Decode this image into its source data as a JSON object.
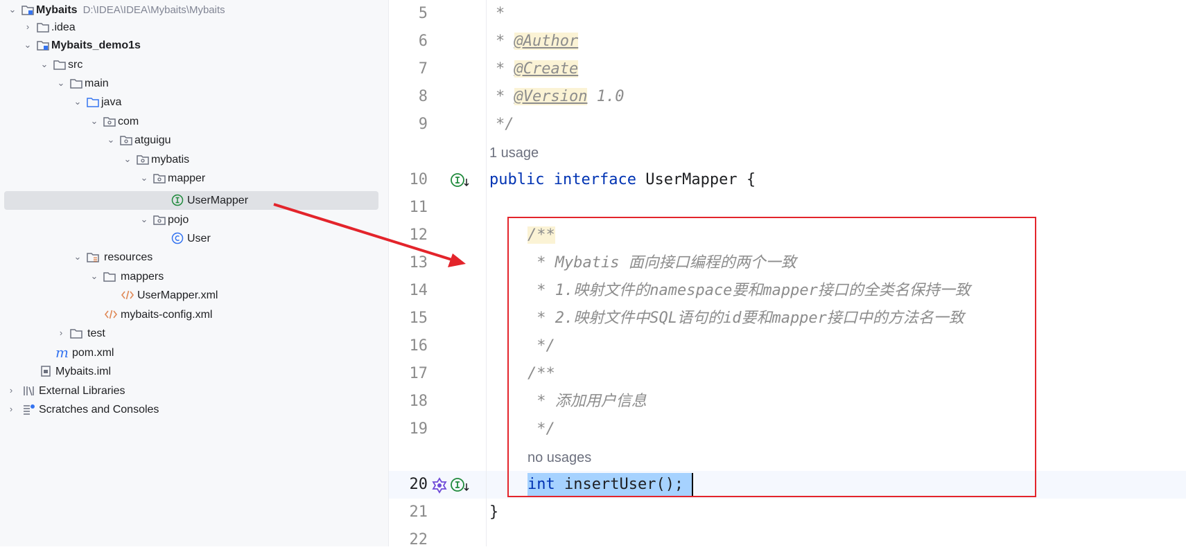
{
  "tree": {
    "root": {
      "name": "Mybaits",
      "path": "D:\\IDEA\\IDEA\\Mybaits\\Mybaits"
    },
    "items": [
      {
        "label": "Mybaits",
        "icon": "module-folder-icon"
      },
      {
        "label": ".idea",
        "icon": "folder-icon"
      },
      {
        "label": "Mybaits_demo1s",
        "icon": "module-folder-icon"
      },
      {
        "label": "src",
        "icon": "folder-icon"
      },
      {
        "label": "main",
        "icon": "folder-icon"
      },
      {
        "label": "java",
        "icon": "source-folder-icon"
      },
      {
        "label": "com",
        "icon": "package-icon"
      },
      {
        "label": "atguigu",
        "icon": "package-icon"
      },
      {
        "label": "mybatis",
        "icon": "package-icon"
      },
      {
        "label": "mapper",
        "icon": "package-icon"
      },
      {
        "label": "UserMapper",
        "icon": "interface-icon"
      },
      {
        "label": "pojo",
        "icon": "package-icon"
      },
      {
        "label": "User",
        "icon": "class-icon"
      },
      {
        "label": "resources",
        "icon": "resources-folder-icon"
      },
      {
        "label": "mappers",
        "icon": "folder-icon"
      },
      {
        "label": "UserMapper.xml",
        "icon": "xml-file-icon"
      },
      {
        "label": "mybaits-config.xml",
        "icon": "xml-file-icon"
      },
      {
        "label": "test",
        "icon": "folder-icon"
      },
      {
        "label": "pom.xml",
        "icon": "maven-icon"
      },
      {
        "label": "Mybaits.iml",
        "icon": "iml-file-icon"
      },
      {
        "label": "External Libraries",
        "icon": "library-icon"
      },
      {
        "label": "Scratches and Consoles",
        "icon": "scratches-icon"
      }
    ]
  },
  "editor": {
    "line_numbers": [
      "5",
      "6",
      "7",
      "8",
      "9",
      "10",
      "11",
      "12",
      "13",
      "14",
      "15",
      "16",
      "17",
      "18",
      "19",
      "20",
      "21",
      "22"
    ],
    "lines": {
      "l5": "*",
      "l6_star": "* ",
      "l6_tag": "@Author",
      "l7_star": "* ",
      "l7_tag": "@Create",
      "l8_star": "* ",
      "l8_tag": "@Version",
      "l8_rest": " 1.0",
      "l9": "*/",
      "usage_hint": "1 usage",
      "l10_kw1": "public",
      "l10_kw2": "interface",
      "l10_rest": " UserMapper {",
      "l12": "/**",
      "l13": " * Mybatis 面向接口编程的两个一致",
      "l14": " * 1.映射文件的namespace要和mapper接口的全类名保持一致",
      "l15": " * 2.映射文件中SQL语句的id要和mapper接口中的方法名一致",
      "l16": " */",
      "l17": "/**",
      "l18": " * 添加用户信息",
      "l19": " */",
      "no_usage_hint": "no usages",
      "l20_kw": "int",
      "l20_rest": " insertUser();",
      "l21": "}"
    }
  },
  "colors": {
    "accent_red": "#e3242b",
    "keyword": "#0033b3",
    "comment": "#8c8c8c"
  }
}
